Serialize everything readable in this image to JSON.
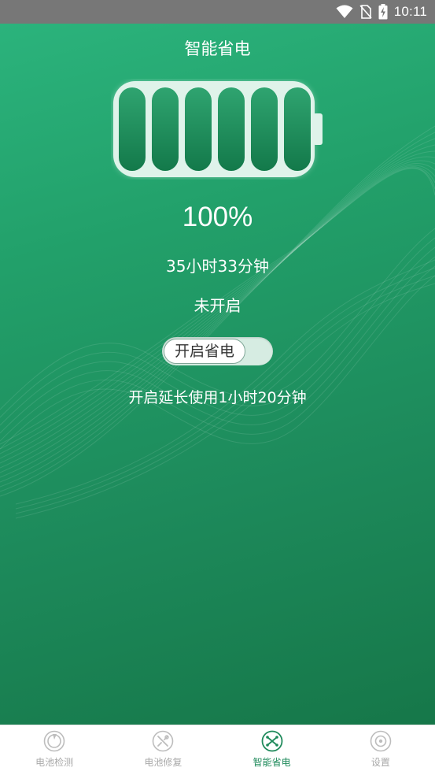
{
  "status_bar": {
    "time": "10:11",
    "icons": [
      "wifi-icon",
      "no-sim-icon",
      "battery-charging-icon"
    ],
    "background": "#777777"
  },
  "main": {
    "title": "智能省电",
    "battery_level_fraction": 1.0,
    "battery_percent": "100%",
    "time_remaining": "35小时33分钟",
    "saver_status": "未开启",
    "toggle_label": "开启省电",
    "extend_text": "开启延长使用1小时20分钟"
  },
  "nav": {
    "items": [
      {
        "label": "电池检测",
        "icon": "battery-test-icon",
        "active": false
      },
      {
        "label": "电池修复",
        "icon": "battery-repair-icon",
        "active": false
      },
      {
        "label": "智能省电",
        "icon": "smart-save-icon",
        "active": true
      },
      {
        "label": "设置",
        "icon": "settings-icon",
        "active": false
      }
    ]
  },
  "colors": {
    "accent": "#1f8a5b",
    "gradient_top": "#2bb37c",
    "gradient_bottom": "#167749",
    "inactive": "#a9a9a9"
  }
}
